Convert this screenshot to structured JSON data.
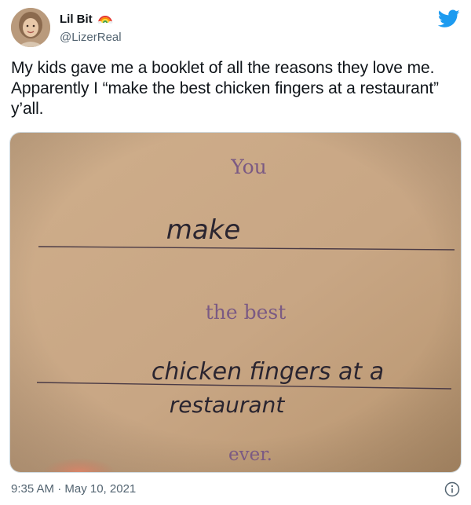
{
  "tweet": {
    "display_name": "Lil Bit",
    "name_emoji_icon": "rainbow-icon",
    "handle": "@LizerReal",
    "text": "My kids gave me a booklet of all the reasons they love me. Apparently I “make the best chicken fingers at a restaurant” y’all.",
    "timestamp": "9:35 AM · May 10, 2021"
  },
  "media": {
    "printed_you": "You",
    "handwritten_1": "make",
    "printed_the_best": "the best",
    "handwritten_2_line1": "chicken fingers at a",
    "handwritten_2_line2": "restaurant",
    "printed_ever": "ever."
  },
  "icons": {
    "brand": "twitter-bird-icon",
    "info": "info-icon",
    "avatar": "avatar"
  },
  "colors": {
    "twitter_blue": "#1d9bf0",
    "text_primary": "#0f1419",
    "text_secondary": "#536471",
    "paper": "#caa987",
    "printed_ink": "#7b5a83",
    "pen_ink": "#2a2530"
  }
}
